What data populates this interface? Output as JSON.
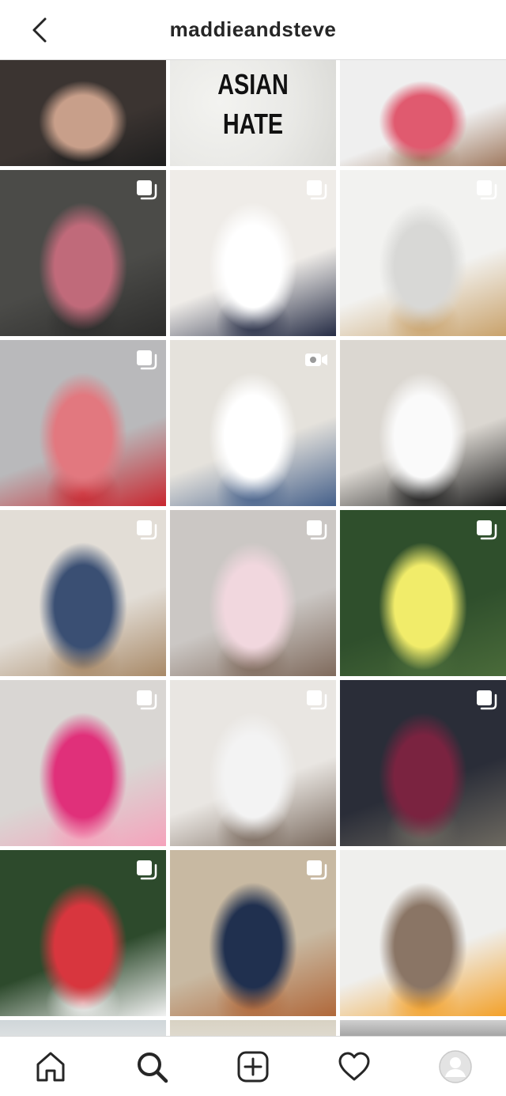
{
  "header": {
    "title": "maddieandsteve",
    "back_icon": "chevron-left-icon"
  },
  "grid": {
    "tiles": [
      {
        "kind": "photo",
        "badge": "none",
        "colors": [
          "#3b3431",
          "#c89f8a",
          "#1e1e1e"
        ]
      },
      {
        "kind": "text",
        "badge": "none",
        "lines": [
          "ASIAN",
          "HATE"
        ],
        "colors": [
          "#e9e9e6",
          "#d9d9d5",
          "#f3f3f0"
        ]
      },
      {
        "kind": "photo",
        "badge": "none",
        "colors": [
          "#efefef",
          "#e05a6f",
          "#a07a60"
        ]
      },
      {
        "kind": "photo",
        "badge": "carousel",
        "colors": [
          "#4b4b48",
          "#c06a7a",
          "#2d2d2c"
        ]
      },
      {
        "kind": "photo",
        "badge": "carousel",
        "colors": [
          "#efece8",
          "#ffffff",
          "#252c45"
        ]
      },
      {
        "kind": "photo",
        "badge": "carousel",
        "colors": [
          "#f2f2f0",
          "#d8d8d6",
          "#c9a26b"
        ]
      },
      {
        "kind": "photo",
        "badge": "carousel",
        "colors": [
          "#b9b9bb",
          "#e2787f",
          "#c8262f"
        ]
      },
      {
        "kind": "photo",
        "badge": "video",
        "colors": [
          "#e5e2dc",
          "#ffffff",
          "#45608a"
        ]
      },
      {
        "kind": "photo",
        "badge": "none",
        "colors": [
          "#dbd7d1",
          "#fafafa",
          "#1a1a1a"
        ]
      },
      {
        "kind": "photo",
        "badge": "carousel",
        "colors": [
          "#e2ddd6",
          "#3a4f73",
          "#a88967"
        ]
      },
      {
        "kind": "photo",
        "badge": "carousel",
        "colors": [
          "#cbc7c4",
          "#f1d7de",
          "#7f6a5c"
        ]
      },
      {
        "kind": "photo",
        "badge": "carousel",
        "colors": [
          "#2f4f2c",
          "#f1ec6a",
          "#4a6b3a"
        ]
      },
      {
        "kind": "photo",
        "badge": "carousel",
        "colors": [
          "#d9d6d3",
          "#e0307a",
          "#f5a3bc"
        ]
      },
      {
        "kind": "photo",
        "badge": "carousel",
        "colors": [
          "#e9e6e2",
          "#f3f3f3",
          "#7a6a5e"
        ]
      },
      {
        "kind": "photo",
        "badge": "carousel",
        "colors": [
          "#2a2d38",
          "#7a2340",
          "#6d6960"
        ]
      },
      {
        "kind": "photo",
        "badge": "carousel",
        "colors": [
          "#2d4a2c",
          "#d8363e",
          "#f2f2f2"
        ]
      },
      {
        "kind": "photo",
        "badge": "carousel",
        "colors": [
          "#c8b9a2",
          "#20304f",
          "#b0683a"
        ]
      },
      {
        "kind": "photo",
        "badge": "none",
        "colors": [
          "#efefed",
          "#8a7565",
          "#f3a12a"
        ]
      }
    ],
    "partial_row": [
      {
        "colors": [
          "#cfd6d9",
          "#e9e9e9"
        ]
      },
      {
        "colors": [
          "#d8d2c3",
          "#e4e0d8"
        ]
      },
      {
        "colors": [
          "#cfcfcf",
          "#7b7b7b"
        ]
      }
    ]
  },
  "bottom_nav": {
    "items": [
      {
        "name": "home",
        "icon": "home-icon"
      },
      {
        "name": "search",
        "icon": "search-icon"
      },
      {
        "name": "create",
        "icon": "plus-square-icon"
      },
      {
        "name": "activity",
        "icon": "heart-icon"
      },
      {
        "name": "profile",
        "icon": "avatar-icon"
      }
    ]
  }
}
